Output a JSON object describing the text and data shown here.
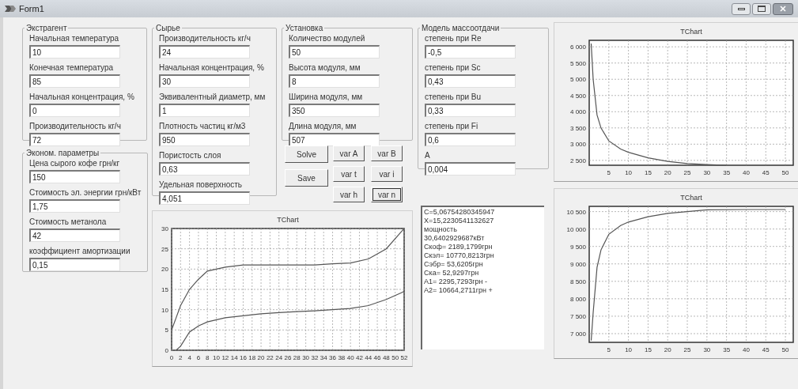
{
  "window": {
    "title": "Form1"
  },
  "extractant": {
    "title": "Экстрагент",
    "fields": [
      {
        "label": "Начальная температура",
        "value": "10"
      },
      {
        "label": "Конечная температура",
        "value": "85"
      },
      {
        "label": "Начальная концентрация, %",
        "value": "0"
      },
      {
        "label": "Производительность кг/ч",
        "value": "72"
      }
    ]
  },
  "economics": {
    "title": "Эконом. параметры",
    "fields": [
      {
        "label": "Цена сырого кофе грн/кг",
        "value": "150"
      },
      {
        "label": "Стоимость эл. энергии грн/кВт",
        "value": "1,75"
      },
      {
        "label": "Стоимость метанола",
        "value": "42"
      },
      {
        "label": "коэффициент амортизации",
        "value": "0,15"
      }
    ]
  },
  "raw_material": {
    "title": "Сырье",
    "fields": [
      {
        "label": "Производительность кг/ч",
        "value": "24"
      },
      {
        "label": "Начальная концентрация, %",
        "value": "30"
      },
      {
        "label": "Эквивалентный диаметр, мм",
        "value": "1"
      },
      {
        "label": "Плотность частиц кг/м3",
        "value": "950"
      },
      {
        "label": "Пористость слоя",
        "value": "0,63"
      },
      {
        "label": "Удельная поверхность",
        "value": "4,051"
      }
    ]
  },
  "unit": {
    "title": "Установка",
    "fields": [
      {
        "label": "Количество модулей",
        "value": "50"
      },
      {
        "label": "Высота модуля, мм",
        "value": "8"
      },
      {
        "label": "Ширина модуля, мм",
        "value": "350"
      },
      {
        "label": "Длина модуля, мм",
        "value": "507"
      }
    ]
  },
  "mass_transfer_model": {
    "title": "Модель массоотдачи",
    "fields": [
      {
        "label": "степень при Re",
        "value": "-0,5"
      },
      {
        "label": "степень при Sc",
        "value": "0,43"
      },
      {
        "label": "степень при Bu",
        "value": "0,33"
      },
      {
        "label": "степень при Fi",
        "value": "0,6"
      },
      {
        "label": "A",
        "value": "0,004"
      }
    ]
  },
  "action_buttons": [
    {
      "label": "Solve",
      "focused": false
    },
    {
      "label": "Save",
      "focused": false
    }
  ],
  "var_buttons": [
    {
      "label": "var A",
      "focused": false
    },
    {
      "label": "var B",
      "focused": false
    },
    {
      "label": "var t",
      "focused": false
    },
    {
      "label": "var i",
      "focused": false
    },
    {
      "label": "var h",
      "focused": false
    },
    {
      "label": "var n",
      "focused": true
    }
  ],
  "memo": {
    "lines": [
      "C=5,06754280345947",
      "X=15,2230541132627",
      "мощность",
      "30,6402929687кВт",
      "Скоф= 2189,1799грн",
      "Скэл= 10770,8213грн",
      "Сэбр= 53,6205грн",
      "Ска= 52,9297грн",
      "A1= 2295,7293грн -",
      "A2= 10664,2711грн +"
    ]
  },
  "plot_main": {
    "chart_data": {
      "type": "line",
      "title": "TChart",
      "x": [
        0,
        1,
        2,
        4,
        6,
        8,
        12,
        16,
        20,
        24,
        28,
        32,
        36,
        40,
        44,
        48,
        52
      ],
      "series": [
        {
          "color": "#555555",
          "values": [
            5,
            8,
            11,
            15,
            17.5,
            19.5,
            20.5,
            21,
            21,
            21,
            21,
            21,
            21.3,
            21.5,
            22.5,
            25,
            30
          ]
        },
        {
          "color": "#555555",
          "values": [
            null,
            0,
            1,
            4.5,
            6,
            7,
            8,
            8.5,
            9,
            9.3,
            9.5,
            9.7,
            10,
            10.3,
            11,
            12.5,
            14.5
          ]
        }
      ],
      "grid": true,
      "xlim": [
        0,
        52
      ],
      "ylim": [
        0,
        30
      ],
      "xticks": [
        0,
        2,
        4,
        6,
        8,
        10,
        12,
        14,
        16,
        18,
        20,
        22,
        24,
        26,
        28,
        30,
        32,
        34,
        36,
        38,
        40,
        42,
        44,
        46,
        48,
        50,
        52
      ],
      "yticks": [
        0,
        5,
        10,
        15,
        20,
        25,
        30
      ]
    }
  },
  "plot_top_right": {
    "chart_data": {
      "type": "line",
      "title": "TChart",
      "x": [
        0.5,
        1,
        2,
        3,
        5,
        8,
        10,
        15,
        20,
        25,
        30,
        35
      ],
      "series": [
        {
          "color": "#555555",
          "values": [
            6100,
            5000,
            3900,
            3500,
            3100,
            2850,
            2750,
            2580,
            2470,
            2400,
            2370,
            2350
          ]
        }
      ],
      "grid": true,
      "xlim": [
        0,
        52
      ],
      "ylim": [
        2350,
        6200
      ],
      "xticks": [
        5,
        10,
        15,
        20,
        25,
        30,
        35,
        40,
        45,
        50
      ],
      "yticks": [
        {
          "value": 2500,
          "label": "2 500"
        },
        {
          "value": 3000,
          "label": "3 000"
        },
        {
          "value": 3500,
          "label": "3 500"
        },
        {
          "value": 4000,
          "label": "4 000"
        },
        {
          "value": 4500,
          "label": "4 500"
        },
        {
          "value": 5000,
          "label": "5 000"
        },
        {
          "value": 5500,
          "label": "5 500"
        },
        {
          "value": 6000,
          "label": "6 000"
        }
      ]
    }
  },
  "plot_bottom_right": {
    "chart_data": {
      "type": "line",
      "title": "TChart",
      "x": [
        0.5,
        1,
        2,
        3,
        5,
        8,
        10,
        15,
        20,
        25,
        30,
        40,
        50
      ],
      "series": [
        {
          "color": "#555555",
          "values": [
            6800,
            7600,
            8900,
            9400,
            9850,
            10100,
            10200,
            10350,
            10450,
            10500,
            10550,
            10560,
            10560
          ]
        }
      ],
      "grid": true,
      "xlim": [
        0,
        52
      ],
      "ylim": [
        6750,
        10650
      ],
      "xticks": [
        5,
        10,
        15,
        20,
        25,
        30,
        35,
        40,
        45,
        50
      ],
      "yticks": [
        {
          "value": 7000,
          "label": "7 000"
        },
        {
          "value": 7500,
          "label": "7 500"
        },
        {
          "value": 8000,
          "label": "8 000"
        },
        {
          "value": 8500,
          "label": "8 500"
        },
        {
          "value": 9000,
          "label": "9 000"
        },
        {
          "value": 9500,
          "label": "9 500"
        },
        {
          "value": 10000,
          "label": "10 000"
        },
        {
          "value": 10500,
          "label": "10 500"
        }
      ]
    }
  }
}
